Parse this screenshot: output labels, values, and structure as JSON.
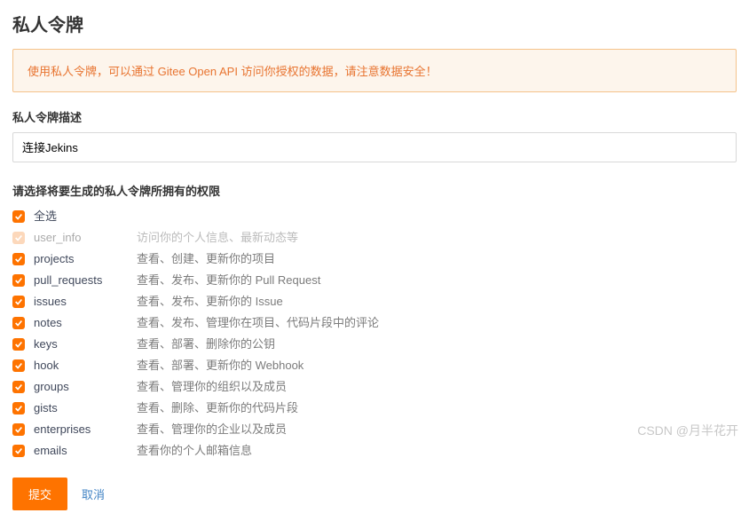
{
  "page": {
    "title": "私人令牌"
  },
  "alert": {
    "prefix": "使用私人令牌，可以通过 ",
    "link": "Gitee Open API",
    "suffix": " 访问你授权的数据，请注意数据安全！"
  },
  "desc": {
    "label": "私人令牌描述",
    "value": "连接Jekins"
  },
  "perms": {
    "label": "请选择将要生成的私人令牌所拥有的权限",
    "select_all": "全选",
    "items": [
      {
        "key": "user_info",
        "desc": "访问你的个人信息、最新动态等",
        "disabled": true
      },
      {
        "key": "projects",
        "desc": "查看、创建、更新你的项目",
        "disabled": false
      },
      {
        "key": "pull_requests",
        "desc": "查看、发布、更新你的 Pull Request",
        "disabled": false
      },
      {
        "key": "issues",
        "desc": "查看、发布、更新你的 Issue",
        "disabled": false
      },
      {
        "key": "notes",
        "desc": "查看、发布、管理你在项目、代码片段中的评论",
        "disabled": false
      },
      {
        "key": "keys",
        "desc": "查看、部署、删除你的公钥",
        "disabled": false
      },
      {
        "key": "hook",
        "desc": "查看、部署、更新你的 Webhook",
        "disabled": false
      },
      {
        "key": "groups",
        "desc": "查看、管理你的组织以及成员",
        "disabled": false
      },
      {
        "key": "gists",
        "desc": "查看、删除、更新你的代码片段",
        "disabled": false
      },
      {
        "key": "enterprises",
        "desc": "查看、管理你的企业以及成员",
        "disabled": false
      },
      {
        "key": "emails",
        "desc": "查看你的个人邮箱信息",
        "disabled": false
      }
    ]
  },
  "actions": {
    "submit": "提交",
    "cancel": "取消"
  },
  "watermark": "CSDN @月半花开"
}
